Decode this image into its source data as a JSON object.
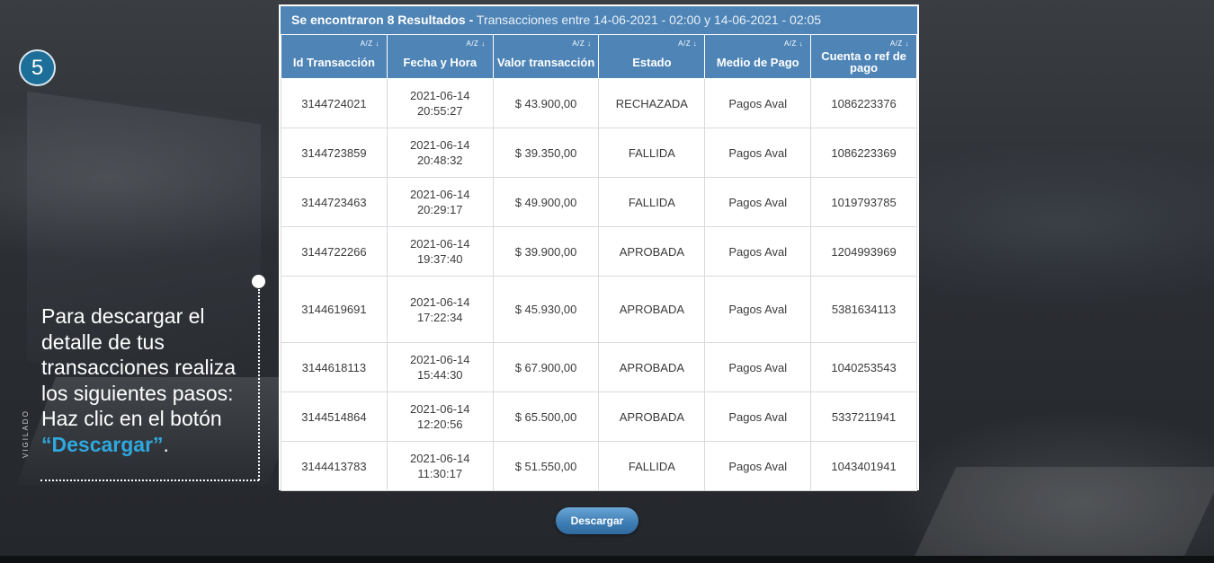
{
  "step": {
    "number": "5"
  },
  "side_label": "VIGILADO",
  "instructions": {
    "text": "Para descargar el detalle de tus transacciones realiza los siguientes pasos: Haz clic en el botón ",
    "highlight": "“Descargar”",
    "end": "."
  },
  "results": {
    "count_text": "Se encontraron 8 Resultados -",
    "range_text": " Transacciones entre 14-06-2021 - 02:00 y 14-06-2021 - 02:05"
  },
  "table": {
    "sort_label": "A/Z ↓",
    "columns": [
      "Id Transacción",
      "Fecha y Hora",
      "Valor transacción",
      "Estado",
      "Medio de Pago",
      "Cuenta o ref de pago"
    ],
    "rows": [
      {
        "id": "3144724021",
        "date": "2021-06-14",
        "time": "20:55:27",
        "value": "$ 43.900,00",
        "status": "RECHAZADA",
        "method": "Pagos Aval",
        "account": "1086223376"
      },
      {
        "id": "3144723859",
        "date": "2021-06-14",
        "time": "20:48:32",
        "value": "$ 39.350,00",
        "status": "FALLIDA",
        "method": "Pagos Aval",
        "account": "1086223369"
      },
      {
        "id": "3144723463",
        "date": "2021-06-14",
        "time": "20:29:17",
        "value": "$ 49.900,00",
        "status": "FALLIDA",
        "method": "Pagos Aval",
        "account": "1019793785"
      },
      {
        "id": "3144722266",
        "date": "2021-06-14",
        "time": "19:37:40",
        "value": "$ 39.900,00",
        "status": "APROBADA",
        "method": "Pagos Aval",
        "account": "1204993969"
      },
      {
        "id": "3144619691",
        "date": "2021-06-14",
        "time": "17:22:34",
        "value": "$ 45.930,00",
        "status": "APROBADA",
        "method": "Pagos Aval",
        "account": "5381634113"
      },
      {
        "id": "3144618113",
        "date": "2021-06-14",
        "time": "15:44:30",
        "value": "$ 67.900,00",
        "status": "APROBADA",
        "method": "Pagos Aval",
        "account": "1040253543"
      },
      {
        "id": "3144514864",
        "date": "2021-06-14",
        "time": "12:20:56",
        "value": "$ 65.500,00",
        "status": "APROBADA",
        "method": "Pagos Aval",
        "account": "5337211941"
      },
      {
        "id": "3144413783",
        "date": "2021-06-14",
        "time": "11:30:17",
        "value": "$ 51.550,00",
        "status": "FALLIDA",
        "method": "Pagos Aval",
        "account": "1043401941"
      }
    ]
  },
  "download_button": {
    "label": "Descargar"
  },
  "colors": {
    "header_blue": "#4e84b6",
    "accent_blue": "#2ea8df",
    "badge_blue": "#1d6f99"
  }
}
